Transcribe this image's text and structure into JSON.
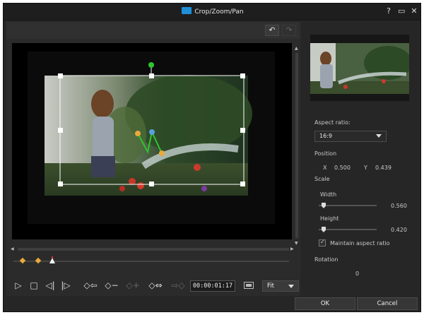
{
  "window": {
    "title": "Crop/Zoom/Pan"
  },
  "titlebar_buttons": [
    "?",
    "▭",
    "✕"
  ],
  "toolbar": {
    "undo_icon": "undo-arrow",
    "redo_icon": "redo-arrow"
  },
  "controls": {
    "timecode": "00:00:01:17",
    "fit_option": "Fit",
    "icons": [
      "play",
      "stop",
      "prev-frame",
      "next-frame",
      "prev-keyframe",
      "remove-keyframe",
      "add-keyframe",
      "duplicate-previous-keyframe",
      "duplicate-next-keyframe",
      "screen"
    ]
  },
  "right": {
    "aspect_ratio_label": "Aspect ratio:",
    "aspect_ratio_value": "16:9",
    "position_label": "Position",
    "x_label": "X",
    "x_value": "0.500",
    "y_label": "Y",
    "y_value": "0.439",
    "scale_label": "Scale",
    "width_label": "Width",
    "width_value": "0.560",
    "height_label": "Height",
    "height_value": "0.420",
    "maintain_label": "Maintain aspect ratio",
    "maintain_checked": true,
    "rotation_label": "Rotation",
    "rotation_value": "0"
  },
  "footer": {
    "ok": "OK",
    "cancel": "Cancel"
  },
  "colors": {
    "accent": "#1f8fd8",
    "keyframe": "#e9a93a",
    "motion_path": "#2fc42f"
  }
}
